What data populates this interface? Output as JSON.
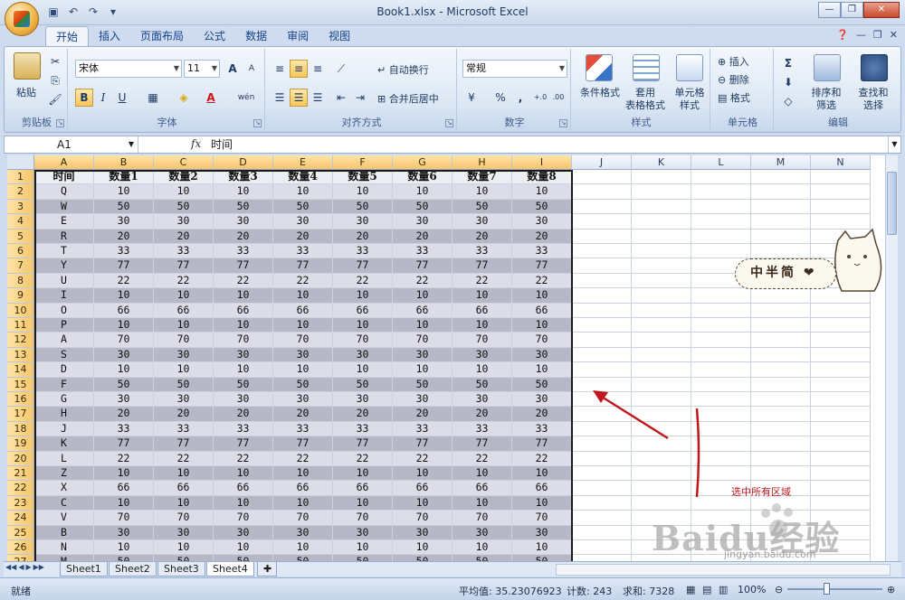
{
  "window": {
    "title": "Book1.xlsx - Microsoft Excel",
    "qat_icons": [
      "save-icon",
      "undo-icon",
      "redo-icon",
      "customize-qat-icon"
    ]
  },
  "tabs": [
    "开始",
    "插入",
    "页面布局",
    "公式",
    "数据",
    "审阅",
    "视图"
  ],
  "ribbon": {
    "clipboard": {
      "paste": "粘贴",
      "group": "剪贴板"
    },
    "font": {
      "name": "宋体",
      "size": "11",
      "group": "字体",
      "bold": "B",
      "italic": "I",
      "underline": "U",
      "grow": "A",
      "shrink": "A",
      "font_color": "A",
      "wen": "wén"
    },
    "alignment": {
      "wrap": "自动换行",
      "merge": "合并后居中",
      "group": "对齐方式"
    },
    "number": {
      "format": "常规",
      "percent": "%",
      "comma": ",",
      "group": "数字"
    },
    "styles": {
      "cond": "条件格式",
      "table1": "套用",
      "table2": "表格格式",
      "cell1": "单元格",
      "cell2": "样式",
      "group": "样式"
    },
    "cells": {
      "insert": "插入",
      "delete": "删除",
      "format": "格式",
      "group": "单元格"
    },
    "editing": {
      "sigma": "Σ",
      "sort1": "排序和",
      "sort2": "筛选",
      "find1": "查找和",
      "find2": "选择",
      "group": "编辑"
    }
  },
  "formula_bar": {
    "name_box": "A1",
    "fx": "fx",
    "content": "时间"
  },
  "grid": {
    "columns": [
      "A",
      "B",
      "C",
      "D",
      "E",
      "F",
      "G",
      "H",
      "I",
      "J",
      "K",
      "L",
      "M",
      "N"
    ],
    "header_row": [
      "时间",
      "数量1",
      "数量2",
      "数量3",
      "数量4",
      "数量5",
      "数量6",
      "数量7",
      "数量8"
    ],
    "rows": [
      [
        "Q",
        "10"
      ],
      [
        "W",
        "50"
      ],
      [
        "E",
        "30"
      ],
      [
        "R",
        "20"
      ],
      [
        "T",
        "33"
      ],
      [
        "Y",
        "77"
      ],
      [
        "U",
        "22"
      ],
      [
        "I",
        "10"
      ],
      [
        "O",
        "66"
      ],
      [
        "P",
        "10"
      ],
      [
        "A",
        "70"
      ],
      [
        "S",
        "30"
      ],
      [
        "D",
        "10"
      ],
      [
        "F",
        "50"
      ],
      [
        "G",
        "30"
      ],
      [
        "H",
        "20"
      ],
      [
        "J",
        "33"
      ],
      [
        "K",
        "77"
      ],
      [
        "L",
        "22"
      ],
      [
        "Z",
        "10"
      ],
      [
        "X",
        "66"
      ],
      [
        "C",
        "10"
      ],
      [
        "V",
        "70"
      ],
      [
        "B",
        "30"
      ],
      [
        "N",
        "10"
      ],
      [
        "M",
        "50"
      ]
    ]
  },
  "sheets": [
    "Sheet1",
    "Sheet2",
    "Sheet3",
    "Sheet4"
  ],
  "status": {
    "mode": "就绪",
    "average": "平均值: 35.23076923",
    "count": "计数: 243",
    "sum": "求和: 7328",
    "zoom": "100%"
  },
  "annotation": {
    "text": "选中所有区域",
    "sticker": "中半简"
  },
  "watermark": {
    "main": "Baidu经验",
    "sub": "jingyan.baidu.com"
  },
  "colors": {
    "ribbon": "#dbe6f4",
    "odd_band": "#b7b8c7",
    "even_band": "#dcdde8",
    "annotation": "#c0161c"
  }
}
